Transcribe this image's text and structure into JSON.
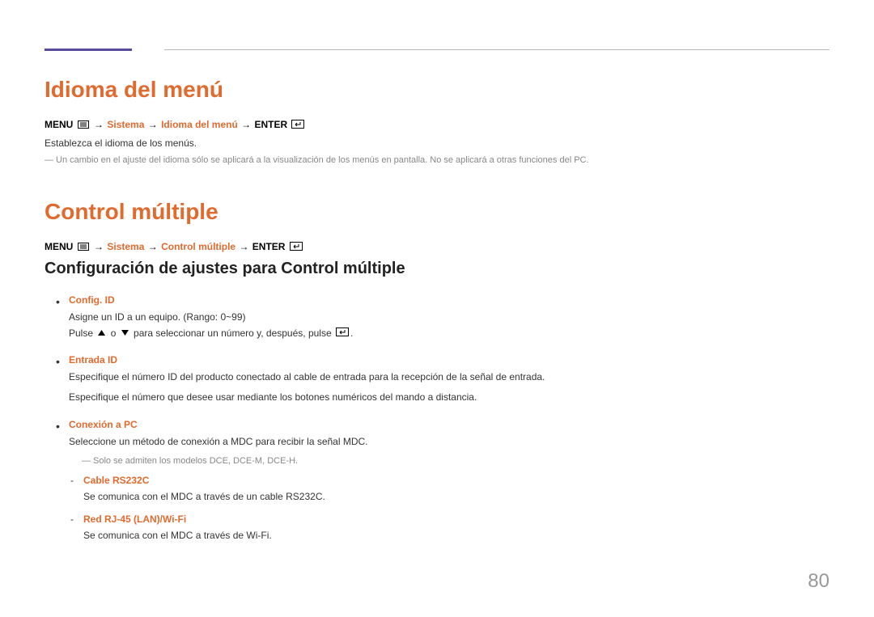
{
  "page_number": "80",
  "section1": {
    "title": "Idioma del menú",
    "nav": {
      "menu": "MENU",
      "arrow": "→",
      "sys": "Sistema",
      "item": "Idioma del menú",
      "enter": "ENTER"
    },
    "desc": "Establezca el idioma de los menús.",
    "note": "Un cambio en el ajuste del idioma sólo se aplicará a la visualización de los menús en pantalla. No se aplicará a otras funciones del PC."
  },
  "section2": {
    "title": "Control múltiple",
    "nav": {
      "menu": "MENU",
      "arrow": "→",
      "sys": "Sistema",
      "item": "Control múltiple",
      "enter": "ENTER"
    },
    "subheading": "Configuración de ajustes para Control múltiple",
    "items": [
      {
        "title": "Config. ID",
        "text1": "Asigne un ID a un equipo. (Rango: 0~99)",
        "text2_a": "Pulse ",
        "text2_b": " o ",
        "text2_c": " para seleccionar un número y, después, pulse ",
        "text2_d": "."
      },
      {
        "title": "Entrada ID",
        "text1": "Especifique el número ID del producto conectado al cable de entrada para la recepción de la señal de entrada.",
        "text2": "Especifique el número que desee usar mediante los botones numéricos del mando a distancia."
      },
      {
        "title": "Conexión a PC",
        "text1": "Seleccione un método de conexión a MDC para recibir la señal MDC.",
        "note": "Solo se admiten los modelos DCE, DCE-M, DCE-H.",
        "sub": [
          {
            "title": "Cable RS232C",
            "text": "Se comunica con el MDC a través de un cable RS232C."
          },
          {
            "title": "Red RJ-45 (LAN)/Wi-Fi",
            "text": "Se comunica con el MDC a través de Wi-Fi."
          }
        ]
      }
    ]
  }
}
